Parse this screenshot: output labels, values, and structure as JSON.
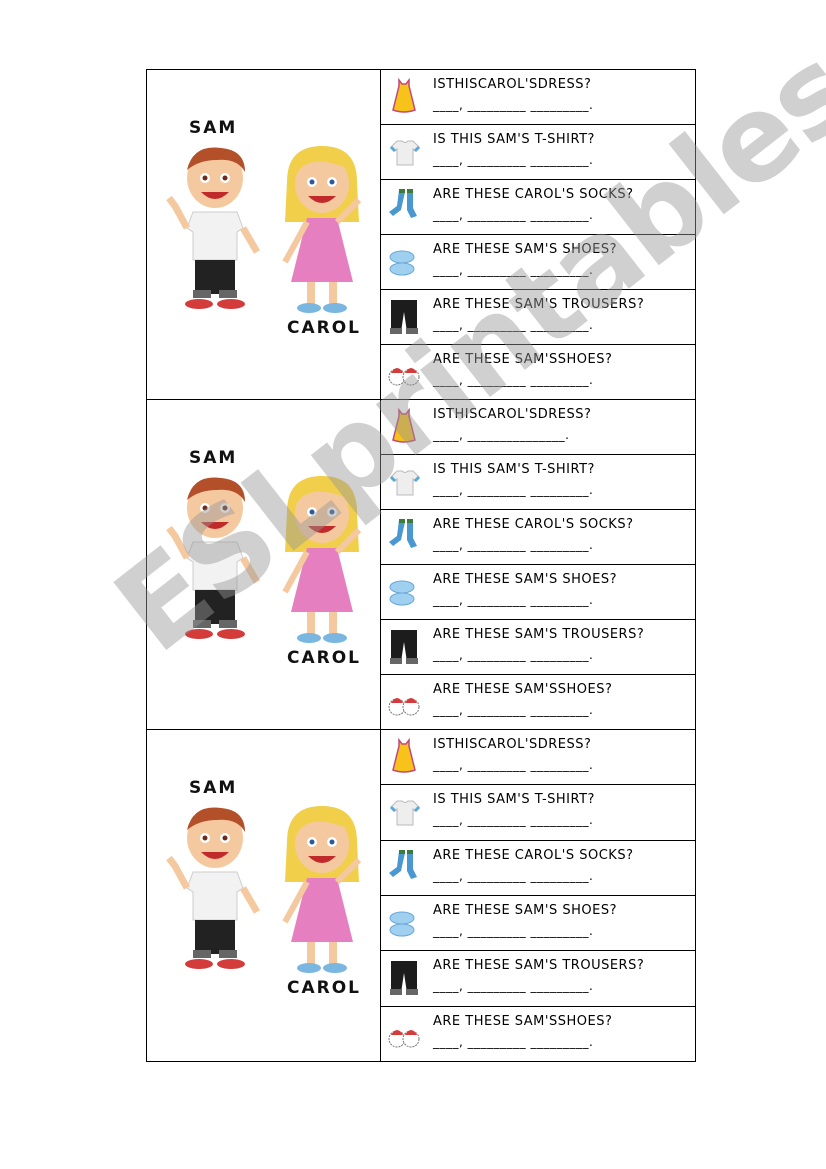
{
  "cards": [
    {
      "names": {
        "boy": "SAM",
        "girl": "CAROL"
      },
      "rows": [
        {
          "icon": "dress-icon",
          "question": "ISTHISCAROL'SDRESS?",
          "answer": "____, _________ _________."
        },
        {
          "icon": "tshirt-icon",
          "question": "IS THIS SAM'S T-SHIRT?",
          "answer": "____, _________ _________."
        },
        {
          "icon": "socks-icon",
          "question": "ARE THESE CAROL'S SOCKS?",
          "answer": "____, _________ _________."
        },
        {
          "icon": "blue-shoes-icon",
          "question": "ARE THESE SAM'S SHOES?",
          "answer": "____, _________ _________."
        },
        {
          "icon": "trousers-icon",
          "question": "ARE THESE SAM'S TROUSERS?",
          "answer": "____, _________ _________."
        },
        {
          "icon": "sneakers-icon",
          "question": "ARE THESE SAM'SSHOES?",
          "answer": "____, _________ _________."
        }
      ]
    },
    {
      "names": {
        "boy": "SAM",
        "girl": "CAROL"
      },
      "rows": [
        {
          "icon": "dress-icon",
          "question": "ISTHISCAROL'SDRESS?",
          "answer": "____, _______________."
        },
        {
          "icon": "tshirt-icon",
          "question": "IS THIS SAM'S T-SHIRT?",
          "answer": "____, _________ _________."
        },
        {
          "icon": "socks-icon",
          "question": "ARE THESE CAROL'S SOCKS?",
          "answer": "____, _________ _________."
        },
        {
          "icon": "blue-shoes-icon",
          "question": "ARE THESE SAM'S SHOES?",
          "answer": "____, _________ _________."
        },
        {
          "icon": "trousers-icon",
          "question": "ARE THESE SAM'S TROUSERS?",
          "answer": "____, _________ _________."
        },
        {
          "icon": "sneakers-icon",
          "question": "ARE THESE SAM'SSHOES?",
          "answer": "____, _________ _________."
        }
      ]
    },
    {
      "names": {
        "boy": "SAM",
        "girl": "CAROL"
      },
      "rows": [
        {
          "icon": "dress-icon",
          "question": "ISTHISCAROL'SDRESS?",
          "answer": "____, _________ _________."
        },
        {
          "icon": "tshirt-icon",
          "question": "IS THIS SAM'S T-SHIRT?",
          "answer": "____, _________ _________."
        },
        {
          "icon": "socks-icon",
          "question": "ARE THESE CAROL'S SOCKS?",
          "answer": "____, _________ _________."
        },
        {
          "icon": "blue-shoes-icon",
          "question": "ARE THESE SAM'S SHOES?",
          "answer": "____, _________ _________."
        },
        {
          "icon": "trousers-icon",
          "question": "ARE THESE SAM'S TROUSERS?",
          "answer": "____, _________ _________."
        },
        {
          "icon": "sneakers-icon",
          "question": "ARE THESE SAM'SSHOES?",
          "answer": "____, _________ _________."
        }
      ]
    }
  ],
  "watermark": "ESLprintables.com"
}
